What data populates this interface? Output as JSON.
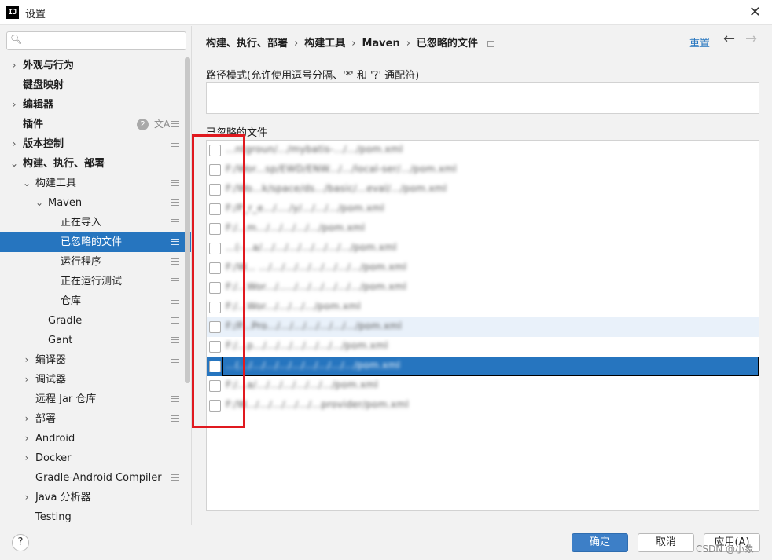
{
  "window": {
    "title": "设置",
    "app_icon": "IJ"
  },
  "search": {
    "placeholder": "",
    "value": ""
  },
  "sidebar": {
    "items": [
      {
        "label": "外观与行为",
        "arrow": "›",
        "bold": true,
        "mark": false
      },
      {
        "label": "键盘映射",
        "arrow": "",
        "bold": true,
        "mark": false
      },
      {
        "label": "编辑器",
        "arrow": "›",
        "bold": true,
        "mark": false
      },
      {
        "label": "插件",
        "arrow": "",
        "bold": true,
        "mark": true,
        "badge": "2",
        "lang": "文A"
      },
      {
        "label": "版本控制",
        "arrow": "›",
        "bold": true,
        "mark": true
      },
      {
        "label": "构建、执行、部署",
        "arrow": "⌄",
        "bold": true,
        "mark": false
      },
      {
        "label": "构建工具",
        "arrow": "⌄",
        "bold": false,
        "mark": true
      },
      {
        "label": "Maven",
        "arrow": "⌄",
        "bold": false,
        "mark": true
      },
      {
        "label": "正在导入",
        "arrow": "",
        "bold": false,
        "mark": true
      },
      {
        "label": "已忽略的文件",
        "arrow": "",
        "bold": false,
        "mark": true,
        "selected": true
      },
      {
        "label": "运行程序",
        "arrow": "",
        "bold": false,
        "mark": true
      },
      {
        "label": "正在运行测试",
        "arrow": "",
        "bold": false,
        "mark": true
      },
      {
        "label": "仓库",
        "arrow": "",
        "bold": false,
        "mark": true
      },
      {
        "label": "Gradle",
        "arrow": "",
        "bold": false,
        "mark": true
      },
      {
        "label": "Gant",
        "arrow": "",
        "bold": false,
        "mark": true
      },
      {
        "label": "编译器",
        "arrow": "›",
        "bold": false,
        "mark": true
      },
      {
        "label": "调试器",
        "arrow": "›",
        "bold": false,
        "mark": false
      },
      {
        "label": "远程 Jar 仓库",
        "arrow": "",
        "bold": false,
        "mark": true
      },
      {
        "label": "部署",
        "arrow": "›",
        "bold": false,
        "mark": true
      },
      {
        "label": "Android",
        "arrow": "›",
        "bold": false,
        "mark": false
      },
      {
        "label": "Docker",
        "arrow": "›",
        "bold": false,
        "mark": false
      },
      {
        "label": "Gradle-Android Compiler",
        "arrow": "",
        "bold": false,
        "mark": true
      },
      {
        "label": "Java 分析器",
        "arrow": "›",
        "bold": false,
        "mark": false
      },
      {
        "label": "Testing",
        "arrow": "",
        "bold": false,
        "mark": false
      }
    ]
  },
  "breadcrumb": [
    "构建、执行、部署",
    "构建工具",
    "Maven",
    "已忽略的文件"
  ],
  "header": {
    "reset": "重置",
    "back": "←",
    "forward": "→"
  },
  "pattern": {
    "label": "路径模式(允许使用逗号分隔、'*' 和 '?' 通配符)",
    "value": ""
  },
  "ignored": {
    "label": "已忽略的文件",
    "files": [
      {
        "name": "...ntgroun/.../mybatis-.../.../pom.xml",
        "checked": false
      },
      {
        "name": "F:/Wor...sp/EWD/ENW.../.../local-ser/.../pom.xml",
        "checked": false
      },
      {
        "name": "F:/Wo...k/space/ds.../basic/...eval/.../pom.xml",
        "checked": false
      },
      {
        "name": "F:/P_r_e.../..../y/.../.../.../pom.xml",
        "checked": false
      },
      {
        "name": "F:/...m.../.../.../.../.../pom.xml",
        "checked": false
      },
      {
        "name": "...(-...a/.../.../.../.../.../.../.../pom.xml",
        "checked": false
      },
      {
        "name": "F:/W...  .../.../.../.../.../.../.../.../pom.xml",
        "checked": false
      },
      {
        "name": "F:/...Wor.../...../.../.../.../.../.../pom.xml",
        "checked": false
      },
      {
        "name": "F:/...Wor.../.../.../.../pom.xml",
        "checked": false
      },
      {
        "name": "F:/P...Pro.../.../.../.../.../.../.../pom.xml",
        "checked": false,
        "hover": true
      },
      {
        "name": "F:/...p.../.../.../.../.../.../.../pom.xml",
        "checked": false
      },
      {
        "name": "...(.../.../.../.../.../.../.../.../.../pom.xml",
        "checked": false,
        "selected": true
      },
      {
        "name": "F:/...a/.../.../.../.../.../.../pom.xml",
        "checked": false
      },
      {
        "name": "F:/W.../.../.../.../.../...provider/pom.xml",
        "checked": false
      }
    ]
  },
  "footer": {
    "help": "?",
    "ok": "确定",
    "cancel": "取消",
    "apply": "应用(A)",
    "watermark": "CSDN @小象"
  },
  "colors": {
    "accent": "#2675bf",
    "annotation": "#e0191f"
  }
}
